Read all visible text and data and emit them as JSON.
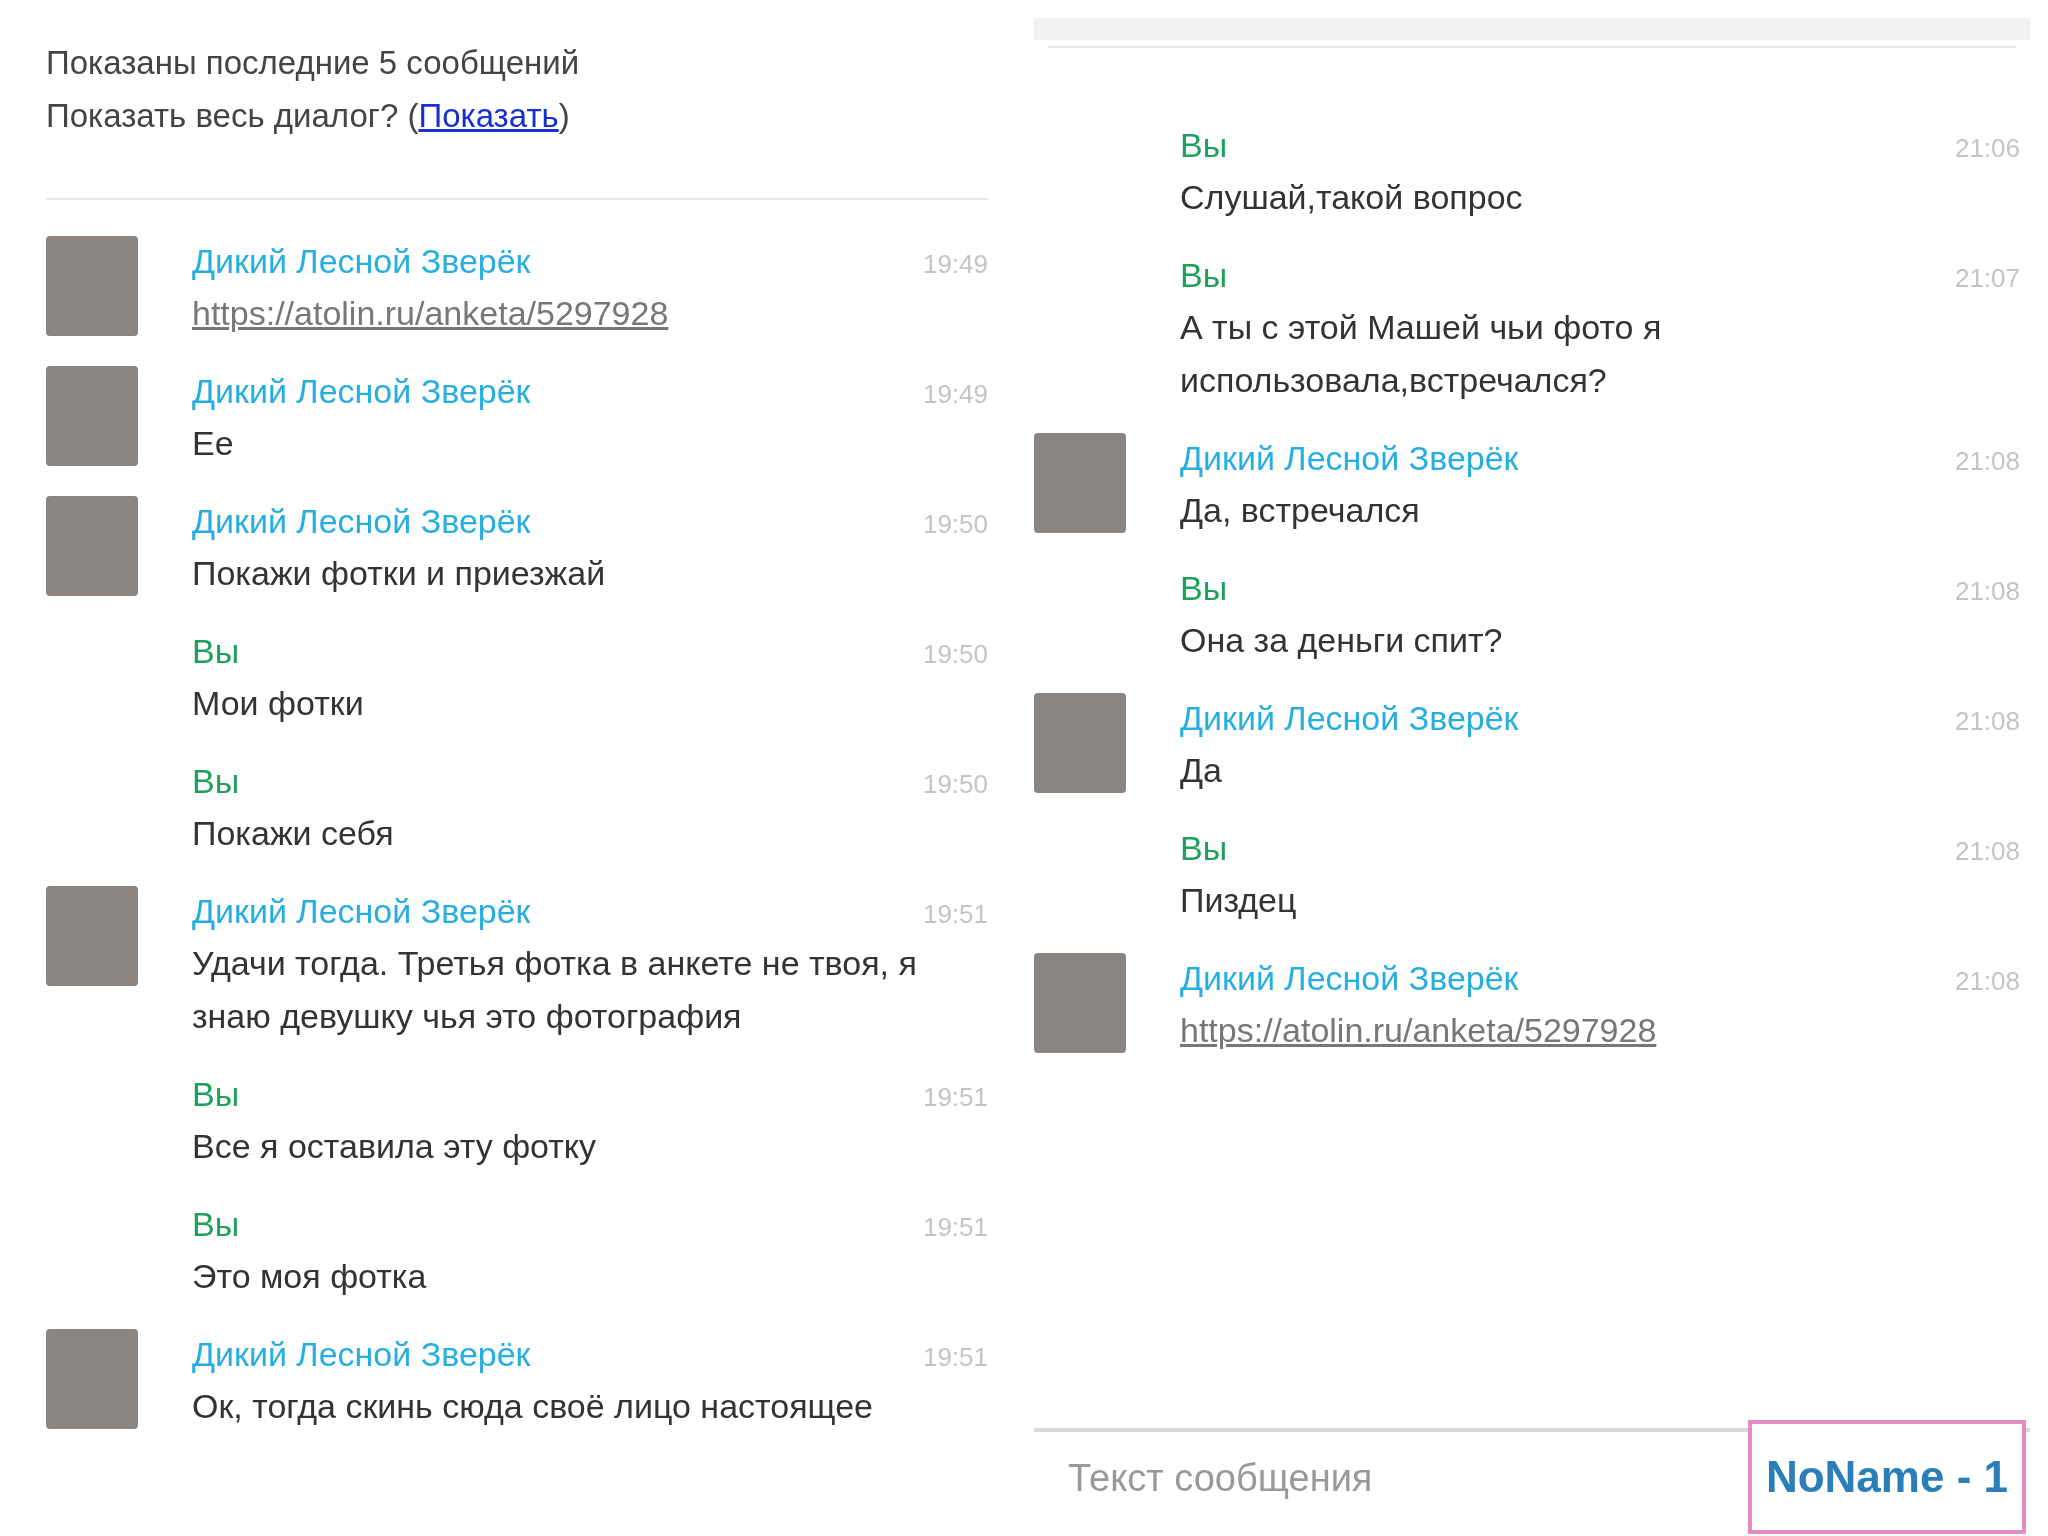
{
  "left_panel": {
    "notice": "Показаны последние 5 сообщений",
    "prompt": {
      "before": "Показать весь диалог? (",
      "link": "Показать",
      "after": ")"
    },
    "messages": [
      {
        "outgoing": false,
        "author": "Дикий Лесной Зверёк",
        "time": "19:49",
        "kind": "link",
        "text": "https://atolin.ru/anketa/5297928"
      },
      {
        "outgoing": false,
        "author": "Дикий Лесной Зверёк",
        "time": "19:49",
        "kind": "text",
        "text": "Ее"
      },
      {
        "outgoing": false,
        "author": "Дикий Лесной Зверёк",
        "time": "19:50",
        "kind": "text",
        "text": "Покажи фотки и приезжай"
      },
      {
        "outgoing": true,
        "author": "Вы",
        "time": "19:50",
        "kind": "text",
        "text": "Мои фотки"
      },
      {
        "outgoing": true,
        "author": "Вы",
        "time": "19:50",
        "kind": "text",
        "text": "Покажи себя"
      },
      {
        "outgoing": false,
        "author": "Дикий Лесной Зверёк",
        "time": "19:51",
        "kind": "text",
        "text": "Удачи тогда. Третья фотка в анкете не твоя, я знаю девушку чья это фотография"
      },
      {
        "outgoing": true,
        "author": "Вы",
        "time": "19:51",
        "kind": "text",
        "text": "Все я оставила эту фотку"
      },
      {
        "outgoing": true,
        "author": "Вы",
        "time": "19:51",
        "kind": "text",
        "text": "Это моя фотка"
      },
      {
        "outgoing": false,
        "author": "Дикий Лесной Зверёк",
        "time": "19:51",
        "kind": "text",
        "text": "Ок, тогда скинь сюда своё лицо настоящее"
      }
    ]
  },
  "right_panel": {
    "messages": [
      {
        "outgoing": true,
        "author": "Вы",
        "time": "21:06",
        "kind": "text",
        "text": "Слушай,такой вопрос"
      },
      {
        "outgoing": true,
        "author": "Вы",
        "time": "21:07",
        "kind": "text",
        "text": "А ты с этой Машей чьи фото я использовала,встречался?"
      },
      {
        "outgoing": false,
        "author": "Дикий Лесной Зверёк",
        "time": "21:08",
        "kind": "text",
        "text": "Да, встречался"
      },
      {
        "outgoing": true,
        "author": "Вы",
        "time": "21:08",
        "kind": "text",
        "text": "Она за деньги спит?"
      },
      {
        "outgoing": false,
        "author": "Дикий Лесной Зверёк",
        "time": "21:08",
        "kind": "text",
        "text": "Да"
      },
      {
        "outgoing": true,
        "author": "Вы",
        "time": "21:08",
        "kind": "text",
        "text": "Пиздец"
      },
      {
        "outgoing": false,
        "author": "Дикий Лесной Зверёк",
        "time": "21:08",
        "kind": "link",
        "text": "https://atolin.ru/anketa/5297928"
      }
    ],
    "input": {
      "placeholder": "Текст сообщения"
    },
    "caption": "NoName - 1"
  }
}
